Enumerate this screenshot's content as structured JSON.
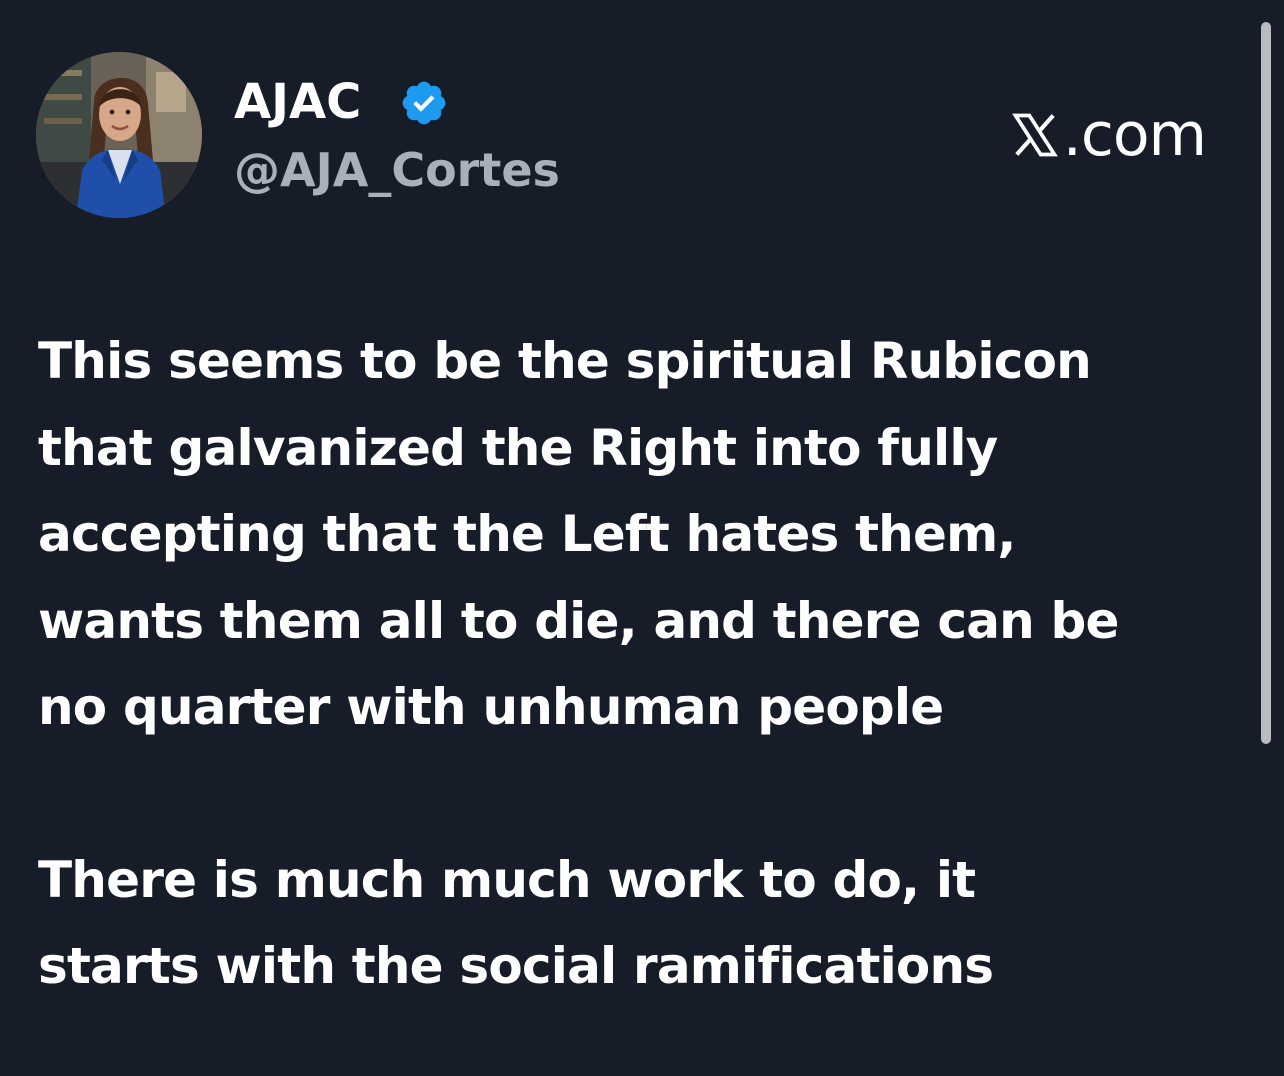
{
  "author": {
    "display_name": "AJAC",
    "handle": "@AJA_Cortes",
    "verified": true,
    "avatar_icon": "profile-photo"
  },
  "brand": {
    "logo_icon": "x-logo-icon",
    "domain_suffix": ".com"
  },
  "post": {
    "paragraphs": [
      "This seems to be the spiritual Rubicon\nthat galvanized the Right into fully\naccepting that the Left hates them,\nwants them all to die, and there can be\nno quarter with unhuman people",
      "There is much much work to do, it\nstarts with the social ramifications"
    ]
  },
  "colors": {
    "background": "#161d29",
    "text": "#ffffff",
    "handle": "#a9b0bb",
    "verified_badge": "#1d9bf0"
  }
}
